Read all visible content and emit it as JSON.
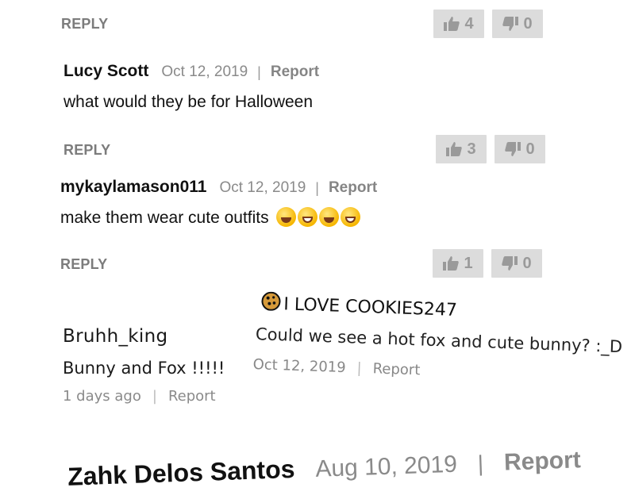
{
  "threads": [
    {
      "reply_label": "REPLY",
      "likes": "4",
      "dislikes": "0"
    },
    {
      "author": "Lucy Scott",
      "date": "Oct 12, 2019",
      "sep": "|",
      "report": "Report",
      "text": "what would they be for Halloween",
      "reply_label": "REPLY",
      "likes": "3",
      "dislikes": "0"
    },
    {
      "author": "mykaylamason011",
      "date": "Oct 12, 2019",
      "sep": "|",
      "report": "Report",
      "text": "make them wear cute outfits",
      "emoji": [
        "laughing-crying-emoji",
        "grinning-emoji",
        "laughing-crying-emoji",
        "grinning-emoji"
      ],
      "reply_label": "REPLY",
      "likes": "1",
      "dislikes": "0"
    }
  ],
  "bruhh": {
    "author": "Bruhh_king",
    "text": "Bunny and Fox !!!!!",
    "time": "1 days ago",
    "sep": "|",
    "report": "Report"
  },
  "cookies": {
    "author": "I LOVE COOKIES247",
    "avatar_icon": "cookie-icon",
    "text": "Could we see a hot fox and cute bunny? :_D",
    "date": "Oct 12, 2019",
    "sep": "|",
    "report": "Report"
  },
  "zahk": {
    "author": "Zahk Delos Santos",
    "date": "Aug 10, 2019",
    "sep": "|",
    "report": "Report"
  },
  "colors": {
    "vote_bg": "#dcdcdc",
    "vote_fg": "#9a9a9a",
    "muted": "#8a8a8a"
  }
}
